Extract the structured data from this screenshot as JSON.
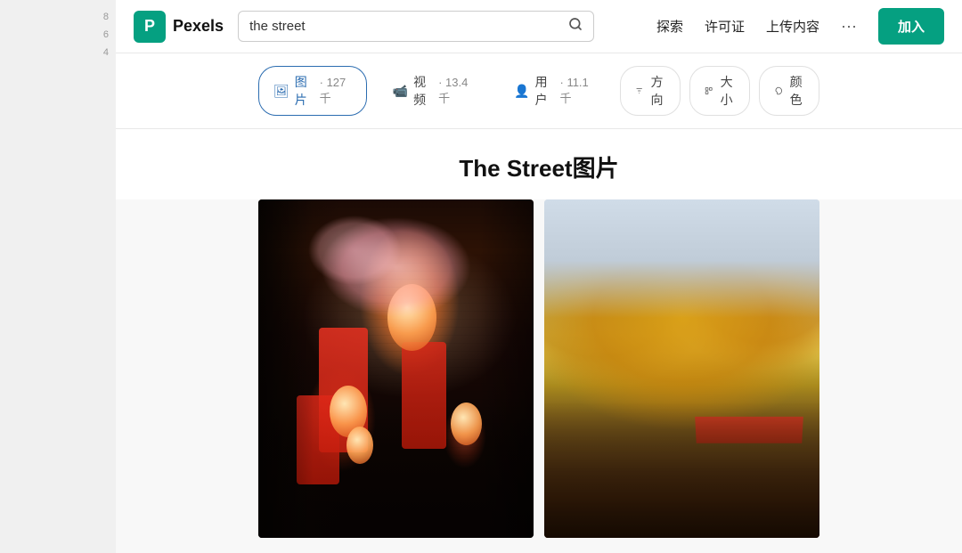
{
  "navbar": {
    "logo_letter": "P",
    "logo_name": "Pexels",
    "search_value": "the street",
    "search_placeholder": "the street",
    "nav_search": "探索",
    "nav_license": "许可证",
    "nav_upload": "上传内容",
    "nav_more": "···",
    "join_label": "加入"
  },
  "filter_bar": {
    "tab_images": "图片",
    "tab_images_count": "· 127 千",
    "tab_videos": "视频",
    "tab_videos_count": "· 13.4 千",
    "tab_users": "用户",
    "tab_users_count": "· 11.1 千",
    "btn_direction": "方向",
    "btn_size": "大小",
    "btn_color": "颜色"
  },
  "page": {
    "title": "The Street图片"
  },
  "side_numbers": [
    "8",
    "6",
    "4"
  ],
  "images": [
    {
      "id": "japan-street",
      "alt": "Japanese street with lanterns and cherry blossoms"
    },
    {
      "id": "autumn-trees",
      "alt": "Autumn trees with orange foliage"
    }
  ]
}
